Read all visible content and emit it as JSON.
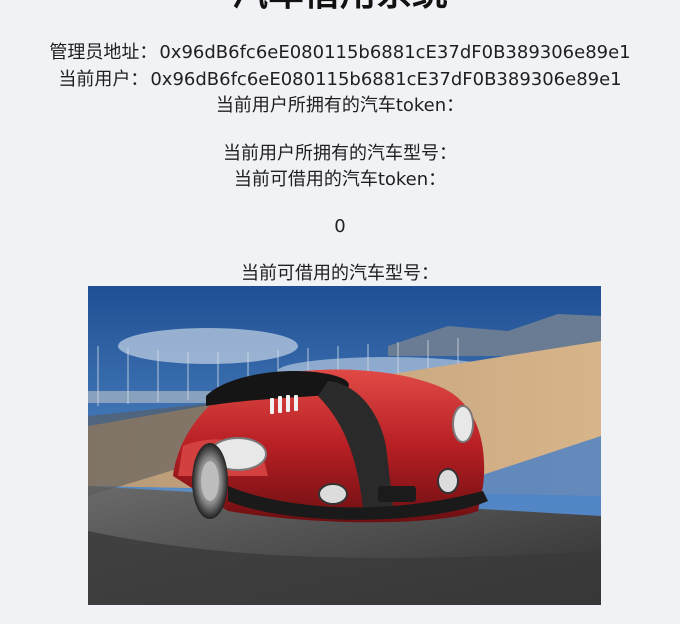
{
  "page": {
    "title": "汽车借用系统"
  },
  "info": {
    "admin_label": "管理员地址：",
    "admin_address": "0x96dB6fc6eE080115b6881cE37dF0B389306e89e1",
    "user_label": "当前用户：",
    "user_address": "0x96dB6fc6eE080115b6881cE37dF0B389306e89e1",
    "owned_tokens_label": "当前用户所拥有的汽车token：",
    "owned_models_label": "当前用户所拥有的汽车型号：",
    "borrowable_tokens_label": "当前可借用的汽车token：",
    "borrowable_tokens_value": "0",
    "borrowable_models_label": "当前可借用的汽车型号："
  },
  "image": {
    "subject": "red-sports-car-photo",
    "colors": {
      "sky": "#3f74b8",
      "car_body": "#c0262a",
      "stripe": "#2a2a2a",
      "track": "#555555",
      "sand": "#c9a57a"
    }
  }
}
